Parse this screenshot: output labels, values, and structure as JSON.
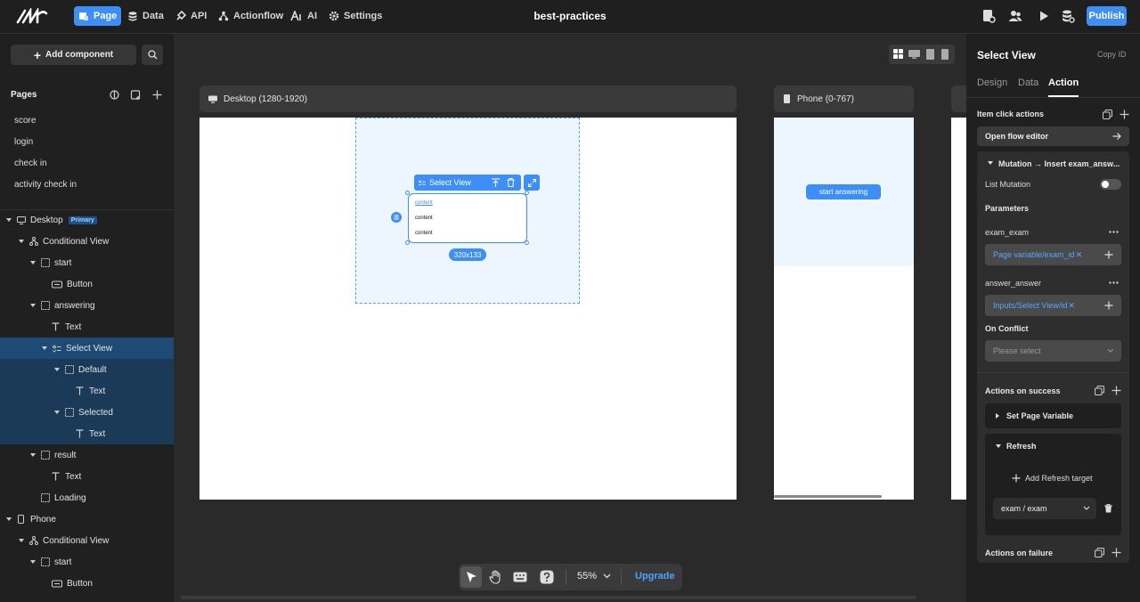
{
  "topbar": {
    "nav": [
      "Page",
      "Data",
      "API",
      "Actionflow",
      "AI",
      "Settings"
    ],
    "title": "best-practices",
    "publish": "Publish"
  },
  "left": {
    "add_component": "Add component",
    "pages_label": "Pages",
    "pages": [
      "score",
      "login",
      "check in",
      "activity check in"
    ],
    "tree": [
      "Desktop",
      "Primary",
      "Conditional View",
      "start",
      "Button",
      "answering",
      "Text",
      "Select View",
      "Default",
      "Text",
      "Selected",
      "Text",
      "result",
      "Text",
      "Loading",
      "Phone",
      "Conditional View",
      "start",
      "Button"
    ]
  },
  "canvas": {
    "desktop_label": "Desktop (1280-1920)",
    "phone_label": "Phone (0-767)",
    "select_view_label": "Select View",
    "items": [
      "content",
      "content",
      "content"
    ],
    "size": "320x133",
    "phone_button": "start answering",
    "zoom": "55%",
    "upgrade": "Upgrade"
  },
  "right": {
    "title": "Select View",
    "copy_id": "Copy ID",
    "tabs": [
      "Design",
      "Data",
      "Action"
    ],
    "item_click_actions": "Item click actions",
    "open_flow_editor": "Open flow editor",
    "mutation": "Mutation → Insert exam_answ...",
    "list_mutation": "List Mutation",
    "parameters": "Parameters",
    "param1_name": "exam_exam",
    "param1_value": "Page variable/exam_id",
    "param2_name": "answer_answer",
    "param2_value": "Inputs/Select View/id",
    "on_conflict": "On Conflict",
    "please_select": "Please select",
    "actions_on_success": "Actions on success",
    "set_page_variable": "Set Page Variable",
    "refresh": "Refresh",
    "add_refresh_target": "Add Refresh target",
    "refresh_target": "exam / exam",
    "actions_on_failure": "Actions on failure"
  },
  "colors": {
    "accent": "#3e8ef7",
    "selection": "#1e4b75"
  }
}
